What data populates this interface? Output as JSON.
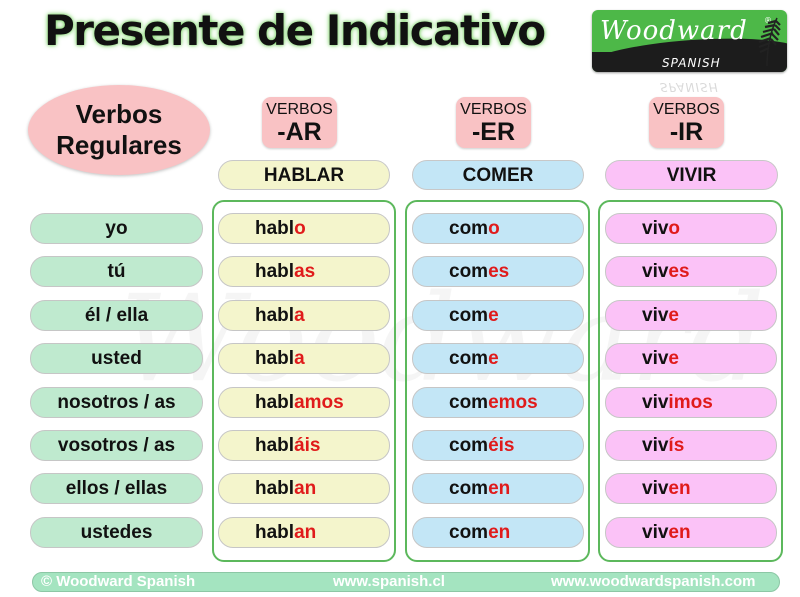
{
  "title": "Presente de Indicativo",
  "logo": {
    "brand": "Woodward",
    "registered": "®",
    "sub": "SPANISH",
    "icon": "fern-icon"
  },
  "heading": {
    "line1": "Verbos",
    "line2": "Regulares"
  },
  "colors": {
    "ending": "#e01b1b",
    "ar": "#f4f5cc",
    "er": "#c3e6f6",
    "ir": "#fbc2f7",
    "pronoun": "#bfeacf",
    "badge": "#f9c2c4",
    "group_border": "#5cb85c",
    "footer": "#a4e4c0"
  },
  "columns": [
    {
      "badge_top": "VERBOS",
      "badge_type": "-AR",
      "infinitive": "HABLAR",
      "forms": [
        {
          "stem": "habl",
          "ending": "o"
        },
        {
          "stem": "habl",
          "ending": "as"
        },
        {
          "stem": "habl",
          "ending": "a"
        },
        {
          "stem": "habl",
          "ending": "a"
        },
        {
          "stem": "habl",
          "ending": "amos"
        },
        {
          "stem": "habl",
          "ending": "áis"
        },
        {
          "stem": "habl",
          "ending": "an"
        },
        {
          "stem": "habl",
          "ending": "an"
        }
      ]
    },
    {
      "badge_top": "VERBOS",
      "badge_type": "-ER",
      "infinitive": "COMER",
      "forms": [
        {
          "stem": "com",
          "ending": "o"
        },
        {
          "stem": "com",
          "ending": "es"
        },
        {
          "stem": "com",
          "ending": "e"
        },
        {
          "stem": "com",
          "ending": "e"
        },
        {
          "stem": "com",
          "ending": "emos"
        },
        {
          "stem": "com",
          "ending": "éis"
        },
        {
          "stem": "com",
          "ending": "en"
        },
        {
          "stem": "com",
          "ending": "en"
        }
      ]
    },
    {
      "badge_top": "VERBOS",
      "badge_type": "-IR",
      "infinitive": "VIVIR",
      "forms": [
        {
          "stem": "viv",
          "ending": "o"
        },
        {
          "stem": "viv",
          "ending": "es"
        },
        {
          "stem": "viv",
          "ending": "e"
        },
        {
          "stem": "viv",
          "ending": "e"
        },
        {
          "stem": "viv",
          "ending": "imos"
        },
        {
          "stem": "viv",
          "ending": "ís"
        },
        {
          "stem": "viv",
          "ending": "en"
        },
        {
          "stem": "viv",
          "ending": "en"
        }
      ]
    }
  ],
  "pronouns": [
    "yo",
    "tú",
    "él / ella",
    "usted",
    "nosotros / as",
    "vosotros / as",
    "ellos / ellas",
    "ustedes"
  ],
  "footer": {
    "copyright": "© Woodward Spanish",
    "site1": "www.spanish.cl",
    "site2": "www.woodwardspanish.com"
  },
  "watermark": "Woodward"
}
